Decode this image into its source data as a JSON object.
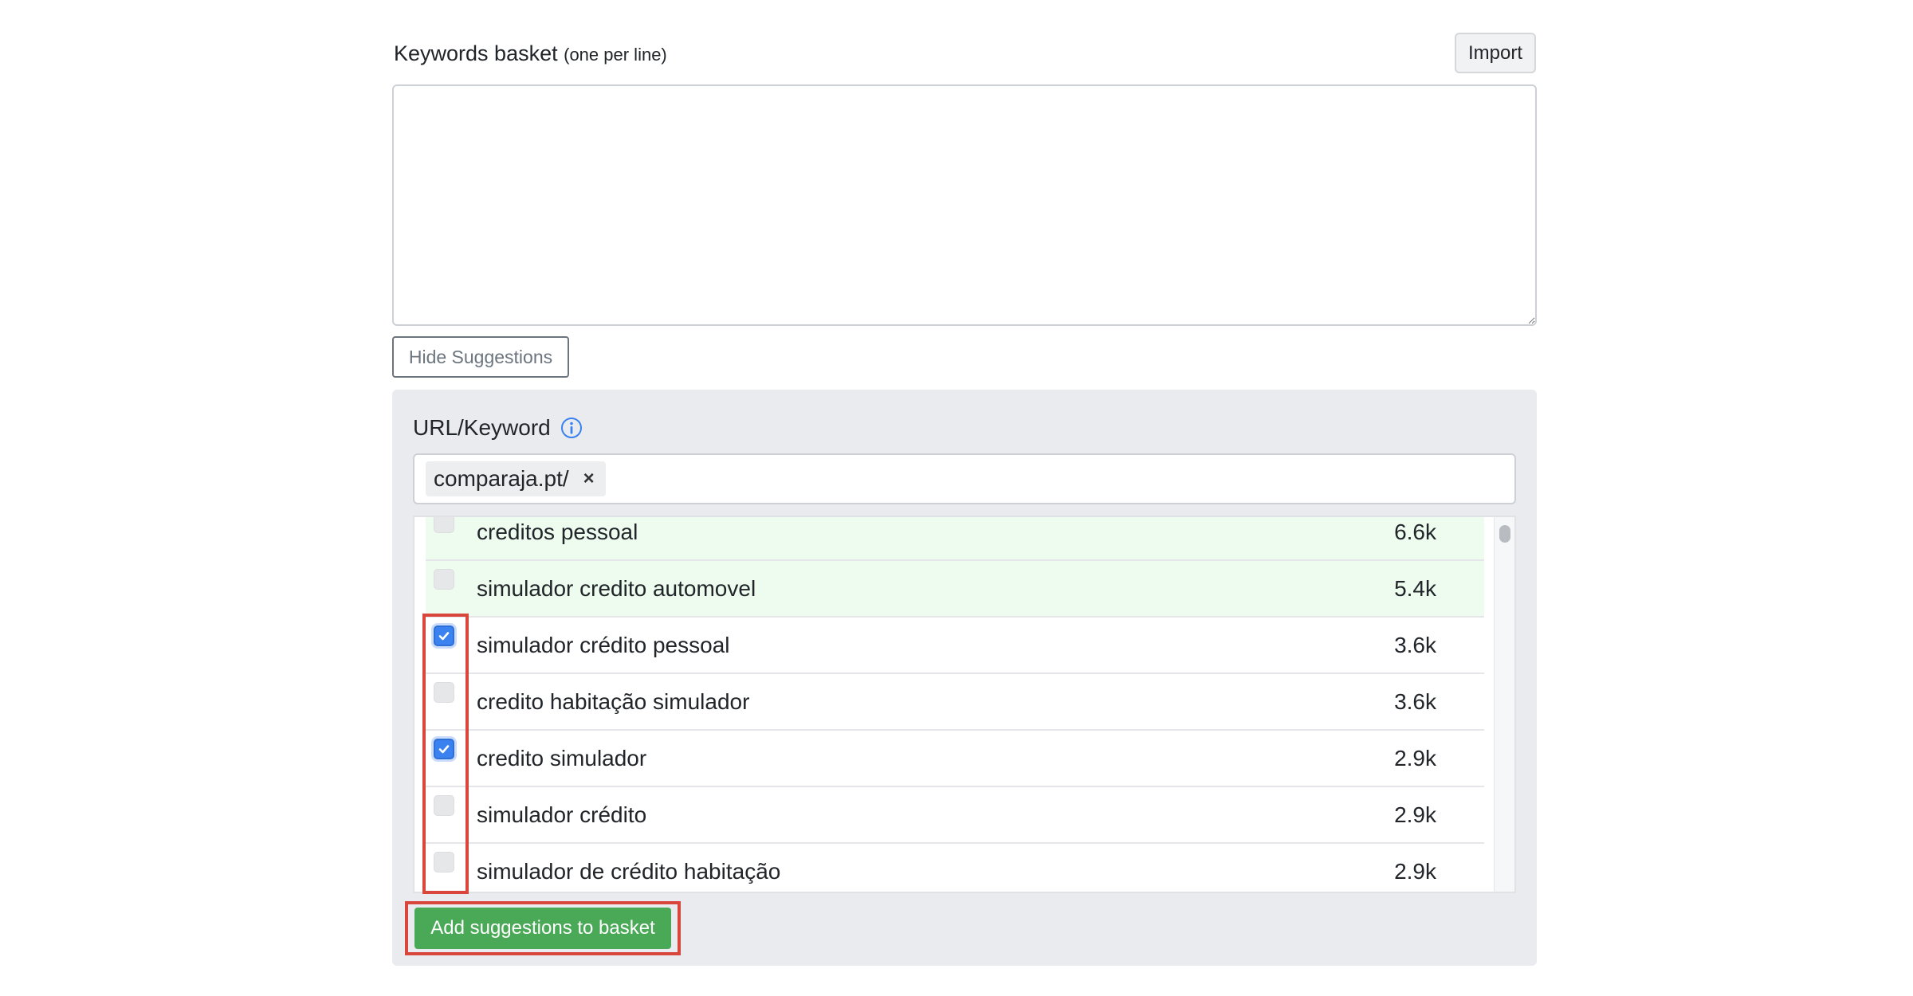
{
  "basket": {
    "label": "Keywords basket",
    "hint": "(one per line)",
    "import_label": "Import",
    "textarea_value": ""
  },
  "hide_suggestions_label": "Hide Suggestions",
  "suggestions": {
    "url_keyword_label": "URL/Keyword",
    "tags": [
      {
        "text": "comparaja.pt/",
        "close": "×"
      }
    ],
    "rows": [
      {
        "keyword": "creditos pessoal",
        "volume": "6.6k",
        "checked": false,
        "highlighted": true
      },
      {
        "keyword": "simulador credito automovel",
        "volume": "5.4k",
        "checked": false,
        "highlighted": true
      },
      {
        "keyword": "simulador crédito pessoal",
        "volume": "3.6k",
        "checked": true,
        "highlighted": false
      },
      {
        "keyword": "credito habitação simulador",
        "volume": "3.6k",
        "checked": false,
        "highlighted": false
      },
      {
        "keyword": "credito simulador",
        "volume": "2.9k",
        "checked": true,
        "highlighted": false
      },
      {
        "keyword": "simulador crédito",
        "volume": "2.9k",
        "checked": false,
        "highlighted": false
      },
      {
        "keyword": "simulador de crédito habitação",
        "volume": "2.9k",
        "checked": false,
        "highlighted": false
      }
    ],
    "add_button_label": "Add suggestions to basket"
  },
  "colors": {
    "add_button": "#4aa957",
    "checkbox_checked": "#3a82f0",
    "highlight_box": "#d9463b",
    "row_green": "#eefcf0",
    "panel_bg": "#e9ebee"
  }
}
